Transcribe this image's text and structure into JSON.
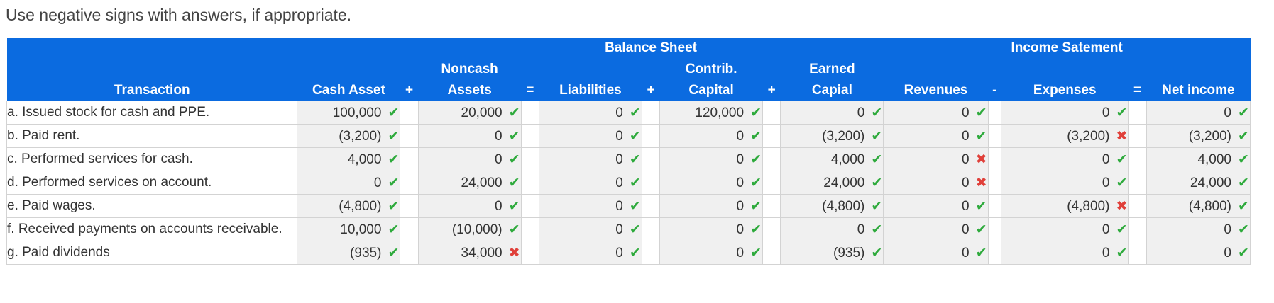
{
  "instruction": "Use negative signs with answers, if appropriate.",
  "groups": {
    "balance_sheet": "Balance Sheet",
    "income_statement": "Income Satement"
  },
  "columns": {
    "transaction": "Transaction",
    "cash_asset": "Cash Asset",
    "noncash_line1": "Noncash",
    "noncash_line2": "Assets",
    "liabilities": "Liabilities",
    "contrib_line1": "Contrib.",
    "contrib_line2": "Capital",
    "earned_line1": "Earned",
    "earned_line2": "Capial",
    "revenues": "Revenues",
    "expenses": "Expenses",
    "net_income": "Net income"
  },
  "operators": {
    "plus": "+",
    "equals": "=",
    "minus": "-"
  },
  "icons": {
    "correct": "check-icon",
    "incorrect": "cross-icon"
  },
  "colors": {
    "header_bg": "#0b6be0",
    "correct": "#2eaa3c",
    "incorrect": "#e0403a",
    "cell_bg": "#f0f0f0"
  },
  "rows": [
    {
      "label": "a. Issued stock for cash and PPE.",
      "cells": [
        {
          "value": "100,000",
          "status": "correct"
        },
        {
          "value": "20,000",
          "status": "correct"
        },
        {
          "value": "0",
          "status": "correct"
        },
        {
          "value": "120,000",
          "status": "correct"
        },
        {
          "value": "0",
          "status": "correct"
        },
        {
          "value": "0",
          "status": "correct"
        },
        {
          "value": "0",
          "status": "correct"
        },
        {
          "value": "0",
          "status": "correct"
        }
      ]
    },
    {
      "label": "b. Paid rent.",
      "cells": [
        {
          "value": "(3,200)",
          "status": "correct"
        },
        {
          "value": "0",
          "status": "correct"
        },
        {
          "value": "0",
          "status": "correct"
        },
        {
          "value": "0",
          "status": "correct"
        },
        {
          "value": "(3,200)",
          "status": "correct"
        },
        {
          "value": "0",
          "status": "correct"
        },
        {
          "value": "(3,200)",
          "status": "incorrect"
        },
        {
          "value": "(3,200)",
          "status": "correct"
        }
      ]
    },
    {
      "label": "c. Performed services for cash.",
      "cells": [
        {
          "value": "4,000",
          "status": "correct"
        },
        {
          "value": "0",
          "status": "correct"
        },
        {
          "value": "0",
          "status": "correct"
        },
        {
          "value": "0",
          "status": "correct"
        },
        {
          "value": "4,000",
          "status": "correct"
        },
        {
          "value": "0",
          "status": "incorrect"
        },
        {
          "value": "0",
          "status": "correct"
        },
        {
          "value": "4,000",
          "status": "correct"
        }
      ]
    },
    {
      "label": "d. Performed services on account.",
      "cells": [
        {
          "value": "0",
          "status": "correct"
        },
        {
          "value": "24,000",
          "status": "correct"
        },
        {
          "value": "0",
          "status": "correct"
        },
        {
          "value": "0",
          "status": "correct"
        },
        {
          "value": "24,000",
          "status": "correct"
        },
        {
          "value": "0",
          "status": "incorrect"
        },
        {
          "value": "0",
          "status": "correct"
        },
        {
          "value": "24,000",
          "status": "correct"
        }
      ]
    },
    {
      "label": "e. Paid wages.",
      "cells": [
        {
          "value": "(4,800)",
          "status": "correct"
        },
        {
          "value": "0",
          "status": "correct"
        },
        {
          "value": "0",
          "status": "correct"
        },
        {
          "value": "0",
          "status": "correct"
        },
        {
          "value": "(4,800)",
          "status": "correct"
        },
        {
          "value": "0",
          "status": "correct"
        },
        {
          "value": "(4,800)",
          "status": "incorrect"
        },
        {
          "value": "(4,800)",
          "status": "correct"
        }
      ]
    },
    {
      "label": "f. Received payments on accounts receivable.",
      "cells": [
        {
          "value": "10,000",
          "status": "correct"
        },
        {
          "value": "(10,000)",
          "status": "correct"
        },
        {
          "value": "0",
          "status": "correct"
        },
        {
          "value": "0",
          "status": "correct"
        },
        {
          "value": "0",
          "status": "correct"
        },
        {
          "value": "0",
          "status": "correct"
        },
        {
          "value": "0",
          "status": "correct"
        },
        {
          "value": "0",
          "status": "correct"
        }
      ]
    },
    {
      "label": "g. Paid dividends",
      "cells": [
        {
          "value": "(935)",
          "status": "correct"
        },
        {
          "value": "34,000",
          "status": "incorrect"
        },
        {
          "value": "0",
          "status": "correct"
        },
        {
          "value": "0",
          "status": "correct"
        },
        {
          "value": "(935)",
          "status": "correct"
        },
        {
          "value": "0",
          "status": "correct"
        },
        {
          "value": "0",
          "status": "correct"
        },
        {
          "value": "0",
          "status": "correct"
        }
      ]
    }
  ]
}
